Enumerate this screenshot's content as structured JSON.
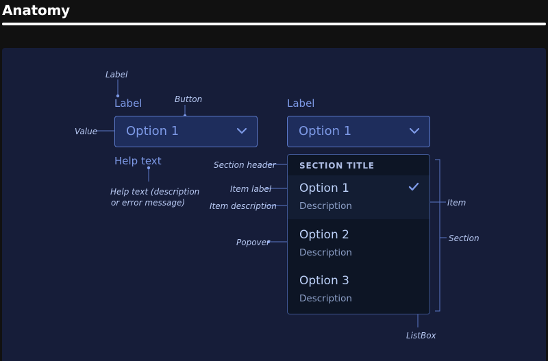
{
  "page": {
    "heading": "Anatomy"
  },
  "annotations": {
    "label": "Label",
    "button": "Button",
    "value": "Value",
    "help_text_line1": "Help text (description",
    "help_text_line2": "or error message)",
    "section_header": "Section header",
    "item_label": "Item label",
    "item_description": "Item description",
    "popover": "Popover",
    "item": "Item",
    "section": "Section",
    "listbox": "ListBox"
  },
  "closed_picker": {
    "label": "Label",
    "value": "Option 1",
    "help_text": "Help text",
    "chevron_icon": "chevron-down-icon"
  },
  "open_picker": {
    "label": "Label",
    "value": "Option 1",
    "chevron_icon": "chevron-down-icon",
    "section_title": "SECTION TITLE",
    "options": [
      {
        "label": "Option 1",
        "description": "Description",
        "selected": true,
        "icon": "checkmark-icon"
      },
      {
        "label": "Option 2",
        "description": "Description",
        "selected": false
      },
      {
        "label": "Option 3",
        "description": "Description",
        "selected": false
      }
    ]
  },
  "colors": {
    "page_background": "#111111",
    "canvas_background": "#161d39",
    "accent": "#7d99e6",
    "annotation_text": "#b7c8f2",
    "annotation_line": "#5c79c9",
    "popover_background": "#0d1525"
  }
}
